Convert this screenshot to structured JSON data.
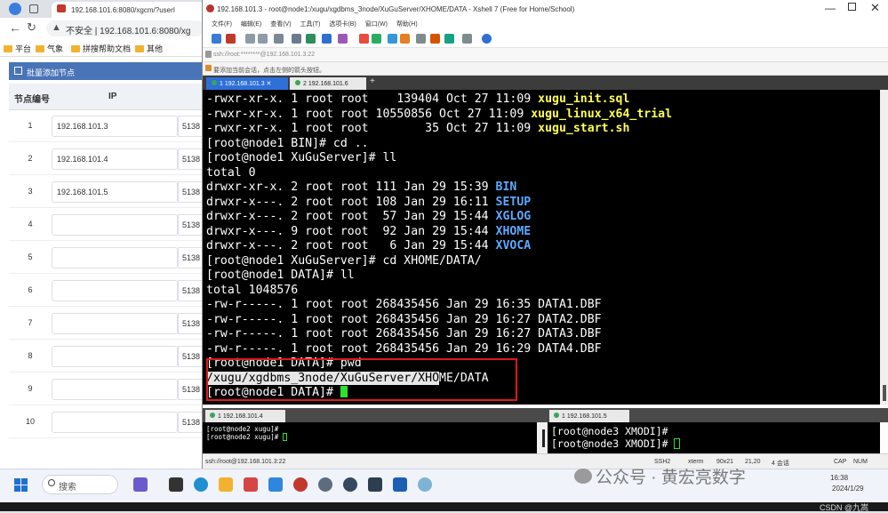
{
  "browser": {
    "tab_title": "192.168.101.6:8080/xgcm/?userI",
    "url_warning": "不安全",
    "url": "192.168.101.6:8080/xg",
    "bookmarks": [
      "平台",
      "气象",
      "拼搜帮助文档",
      "其他"
    ],
    "panel_title": "批量添加节点",
    "table": {
      "headers": [
        "节点编号",
        "IP"
      ],
      "rows": [
        {
          "num": "1",
          "ip": "192.168.101.3",
          "port": "5138"
        },
        {
          "num": "2",
          "ip": "192.168.101.4",
          "port": "5138"
        },
        {
          "num": "3",
          "ip": "192.168.101.5",
          "port": "5138"
        },
        {
          "num": "4",
          "ip": "",
          "port": "5138"
        },
        {
          "num": "5",
          "ip": "",
          "port": "5138"
        },
        {
          "num": "6",
          "ip": "",
          "port": "5138"
        },
        {
          "num": "7",
          "ip": "",
          "port": "5138"
        },
        {
          "num": "8",
          "ip": "",
          "port": "5138"
        },
        {
          "num": "9",
          "ip": "",
          "port": "5138"
        },
        {
          "num": "10",
          "ip": "",
          "port": "5138"
        }
      ]
    }
  },
  "xshell": {
    "title": "192.168.101.3 - root@node1:/xugu/xgdbms_3node/XuGuServer/XHOME/DATA - Xshell 7 (Free for Home/School)",
    "menu": [
      "文件(F)",
      "编辑(E)",
      "查看(V)",
      "工具(T)",
      "选项卡(B)",
      "窗口(W)",
      "帮助(H)"
    ],
    "address": "ssh://root:********@192.168.101.3:22",
    "hint": "要添加当前会话，点击左侧的箭头按钮。",
    "tabs": [
      "1 192.168.101.3",
      "2 192.168.101.6"
    ],
    "add_tab": "+",
    "terminal": {
      "listing1": [
        {
          "perm": "-rwxr-xr-x. 1 root root    139404 Oct 27 11:09 ",
          "name": "xugu_init.sql"
        },
        {
          "perm": "-rwxr-xr-x. 1 root root 10550856 Oct 27 11:09 ",
          "name": "xugu_linux_x64_trial"
        },
        {
          "perm": "-rwxr-xr-x. 1 root root        35 Oct 27 11:09 ",
          "name": "xugu_start.sh"
        }
      ],
      "cmd_cd": "[root@node1 BIN]# cd ..",
      "cmd_ll": "[root@node1 XuGuServer]# ll",
      "total0": "total 0",
      "dirs": [
        {
          "perm": "drwxr-xr-x. 2 root root 111 Jan 29 15:39 ",
          "name": "BIN"
        },
        {
          "perm": "drwxr-x---. 2 root root 108 Jan 29 16:11 ",
          "name": "SETUP"
        },
        {
          "perm": "drwxr-x---. 2 root root  57 Jan 29 15:44 ",
          "name": "XGLOG"
        },
        {
          "perm": "drwxr-x---. 9 root root  92 Jan 29 15:44 ",
          "name": "XHOME"
        },
        {
          "perm": "drwxr-x---. 2 root root   6 Jan 29 15:44 ",
          "name": "XVOCA"
        }
      ],
      "cmd_cd2": "[root@node1 XuGuServer]# cd XHOME/DATA/",
      "cmd_ll2": "[root@node1 DATA]# ll",
      "total1": "total 1048576",
      "files": [
        "-rw-r-----. 1 root root 268435456 Jan 29 16:35 DATA1.DBF",
        "-rw-r-----. 1 root root 268435456 Jan 29 16:27 DATA2.DBF",
        "-rw-r-----. 1 root root 268435456 Jan 29 16:27 DATA3.DBF",
        "-rw-r-----. 1 root root 268435456 Jan 29 16:29 DATA4.DBF"
      ],
      "cmd_pwd": "[root@node1 DATA]# pwd",
      "pwd_sel": "/xugu/xgdbms_3node/XuGuServer/XHO",
      "pwd_rest": "ME/DATA",
      "prompt": "[root@node1 DATA]# "
    },
    "pane_tabs": [
      "1 192.168.101.4",
      "1 192.168.101.5"
    ],
    "pane1_lines": [
      "[root@node2 xugu]#",
      "[root@node2 xugu]# "
    ],
    "pane2_lines": [
      "[root@node3 XMODI]#",
      "[root@node3 XMODI]# "
    ],
    "status": {
      "left": "ssh://root@192.168.101.3:22",
      "proto": "SSH2",
      "term": "xterm",
      "size": "90x21",
      "pos": "21,20",
      "sessions": "4 会话",
      "caps": "CAP",
      "num": "NUM"
    }
  },
  "taskbar": {
    "search": "搜索",
    "time": "16:38",
    "date": "2024/1/29"
  },
  "watermark": "公众号 · 黄宏亮数字",
  "csdn": "CSDN @九嵩"
}
